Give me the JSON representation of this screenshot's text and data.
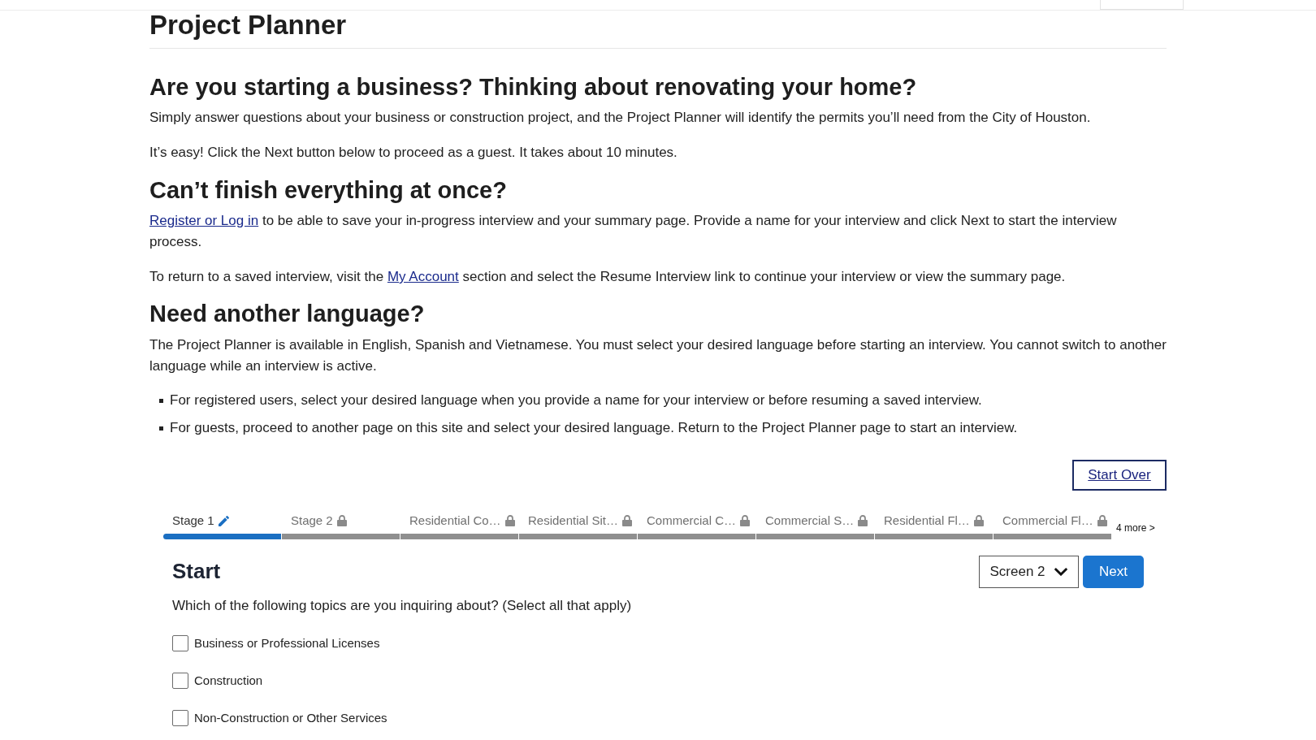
{
  "header": {
    "title": "Project Planner"
  },
  "intro": {
    "heading": "Are you starting a business? Thinking about renovating your home?",
    "paragraphs": [
      "Simply answer questions about your business or construction project, and the Project Planner will identify the permits you’ll need from the City of Houston.",
      "It’s easy! Click the Next button below to proceed as a guest. It takes about 10 minutes."
    ]
  },
  "save": {
    "heading": "Can’t finish everything at once?",
    "paragraphs": [
      [
        {
          "kind": "link",
          "text": "Register or Log in"
        },
        {
          "kind": "text",
          "text": " to be able to save your in-progress interview and your summary page. Provide a name for your interview and click Next to start the interview process."
        }
      ],
      [
        {
          "kind": "text",
          "text": "To return to a saved interview, visit the "
        },
        {
          "kind": "link",
          "text": "My Account"
        },
        {
          "kind": "text",
          "text": " section and select the Resume Interview link to continue your interview or view the summary page."
        }
      ]
    ]
  },
  "language": {
    "heading": "Need another language?",
    "paragraph": "The Project Planner is available in English, Spanish and Vietnamese. You must select your desired language before starting an interview. You cannot switch to another language while an interview is active.",
    "bullets": [
      "For registered users, select your desired language when you provide a name for your interview or before resuming a saved interview.",
      "For guests, proceed to another page on this site and select your desired language. Return to the Project Planner page to start an interview."
    ]
  },
  "start_over_button": "Start Over",
  "stages": {
    "tabs": [
      {
        "label": "Stage 1",
        "selected": true,
        "locked": false
      },
      {
        "label": "Stage 2",
        "selected": false,
        "locked": true
      },
      {
        "label": "Residential Co…",
        "selected": false,
        "locked": true
      },
      {
        "label": "Residential Sit…",
        "selected": false,
        "locked": true
      },
      {
        "label": "Commercial C…",
        "selected": false,
        "locked": true
      },
      {
        "label": "Commercial S…",
        "selected": false,
        "locked": true
      },
      {
        "label": "Residential Fl…",
        "selected": false,
        "locked": true
      },
      {
        "label": "Commercial Fl…",
        "selected": false,
        "locked": true
      }
    ],
    "more_link": "4 more >"
  },
  "interview": {
    "title": "Start",
    "screen_select": {
      "value": "Screen 2"
    },
    "next_button": "Next",
    "question": "Which of the following topics are you inquiring about? (Select all that apply)",
    "options": [
      {
        "label": "Business or Professional Licenses",
        "checked": false
      },
      {
        "label": "Construction",
        "checked": false
      },
      {
        "label": "Non-Construction or Other Services",
        "checked": false
      }
    ]
  }
}
